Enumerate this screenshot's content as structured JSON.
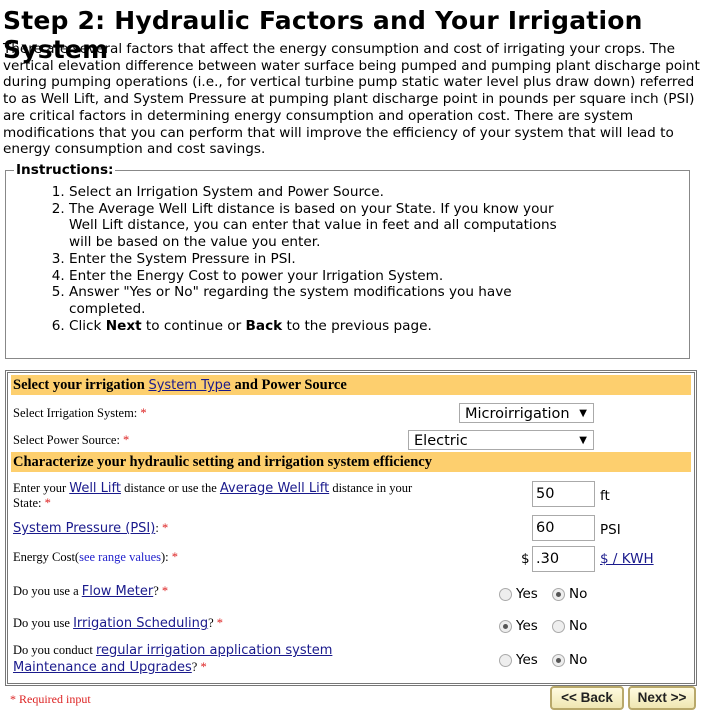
{
  "title": "Step 2: Hydraulic Factors and Your Irrigation System",
  "intro": "There are several factors that affect the energy consumption and cost of irrigating your crops. The vertical elevation difference between water surface being pumped and pumping plant discharge point during pumping operations (i.e., for vertical turbine pump static water level plus draw down) referred to as Well Lift, and System Pressure at pumping plant discharge point in pounds per square inch (PSI) are critical factors in determining energy consumption and operation cost. There are system modifications that you can perform that will improve the efficiency of your system that will lead to energy consumption and cost savings.",
  "instructions": {
    "legend": "Instructions:",
    "items": [
      "Select an Irrigation System and Power Source.",
      "The Average Well Lift distance is based on your State. If you know your Well Lift distance, you can enter that value in feet and all computations will be based on the value you enter.",
      "Enter the System Pressure in PSI.",
      "Enter the Energy Cost to power your Irrigation System.",
      "Answer \"Yes or No\" regarding the system modifications you have completed."
    ],
    "last": {
      "a": "Click ",
      "next": "Next",
      "b": " to continue or ",
      "back": "Back",
      "c": " to the previous page."
    }
  },
  "section1": {
    "pre": "Select your irrigation ",
    "link": "System Type",
    "post": " and Power Source"
  },
  "irrigation_system": {
    "label": "Select Irrigation System: ",
    "value": "Microirrigation"
  },
  "power_source": {
    "label": "Select Power Source: ",
    "value": "Electric"
  },
  "section2": "Characterize your hydraulic setting and irrigation system efficiency",
  "well_lift": {
    "a": "Enter your ",
    "link1": "Well Lift",
    "b": " distance or use the ",
    "link2": "Average Well Lift",
    "c": " distance in your State: ",
    "value": "50",
    "unit": "ft"
  },
  "pressure": {
    "link": "System Pressure (PSI)",
    "post": ": ",
    "value": "60",
    "unit": "PSI"
  },
  "energy": {
    "a": "Energy Cost(",
    "link": "see range values",
    "b": "): ",
    "currency": "$",
    "value": ".30",
    "unit": "$ / KWH"
  },
  "flow_meter": {
    "a": "Do you use a ",
    "link": "Flow Meter",
    "b": "? ",
    "selected": "No"
  },
  "scheduling": {
    "a": "Do you use ",
    "link": "Irrigation Scheduling",
    "b": "? ",
    "selected": "Yes"
  },
  "maintenance": {
    "a": "Do you conduct ",
    "link": "regular irrigation application system Maintenance and Upgrades",
    "b": "? ",
    "selected": "No"
  },
  "radio": {
    "yes": "Yes",
    "no": "No"
  },
  "required_mark": "*",
  "required_note": "* Required input",
  "buttons": {
    "back": "<< Back",
    "next": "Next >>"
  }
}
